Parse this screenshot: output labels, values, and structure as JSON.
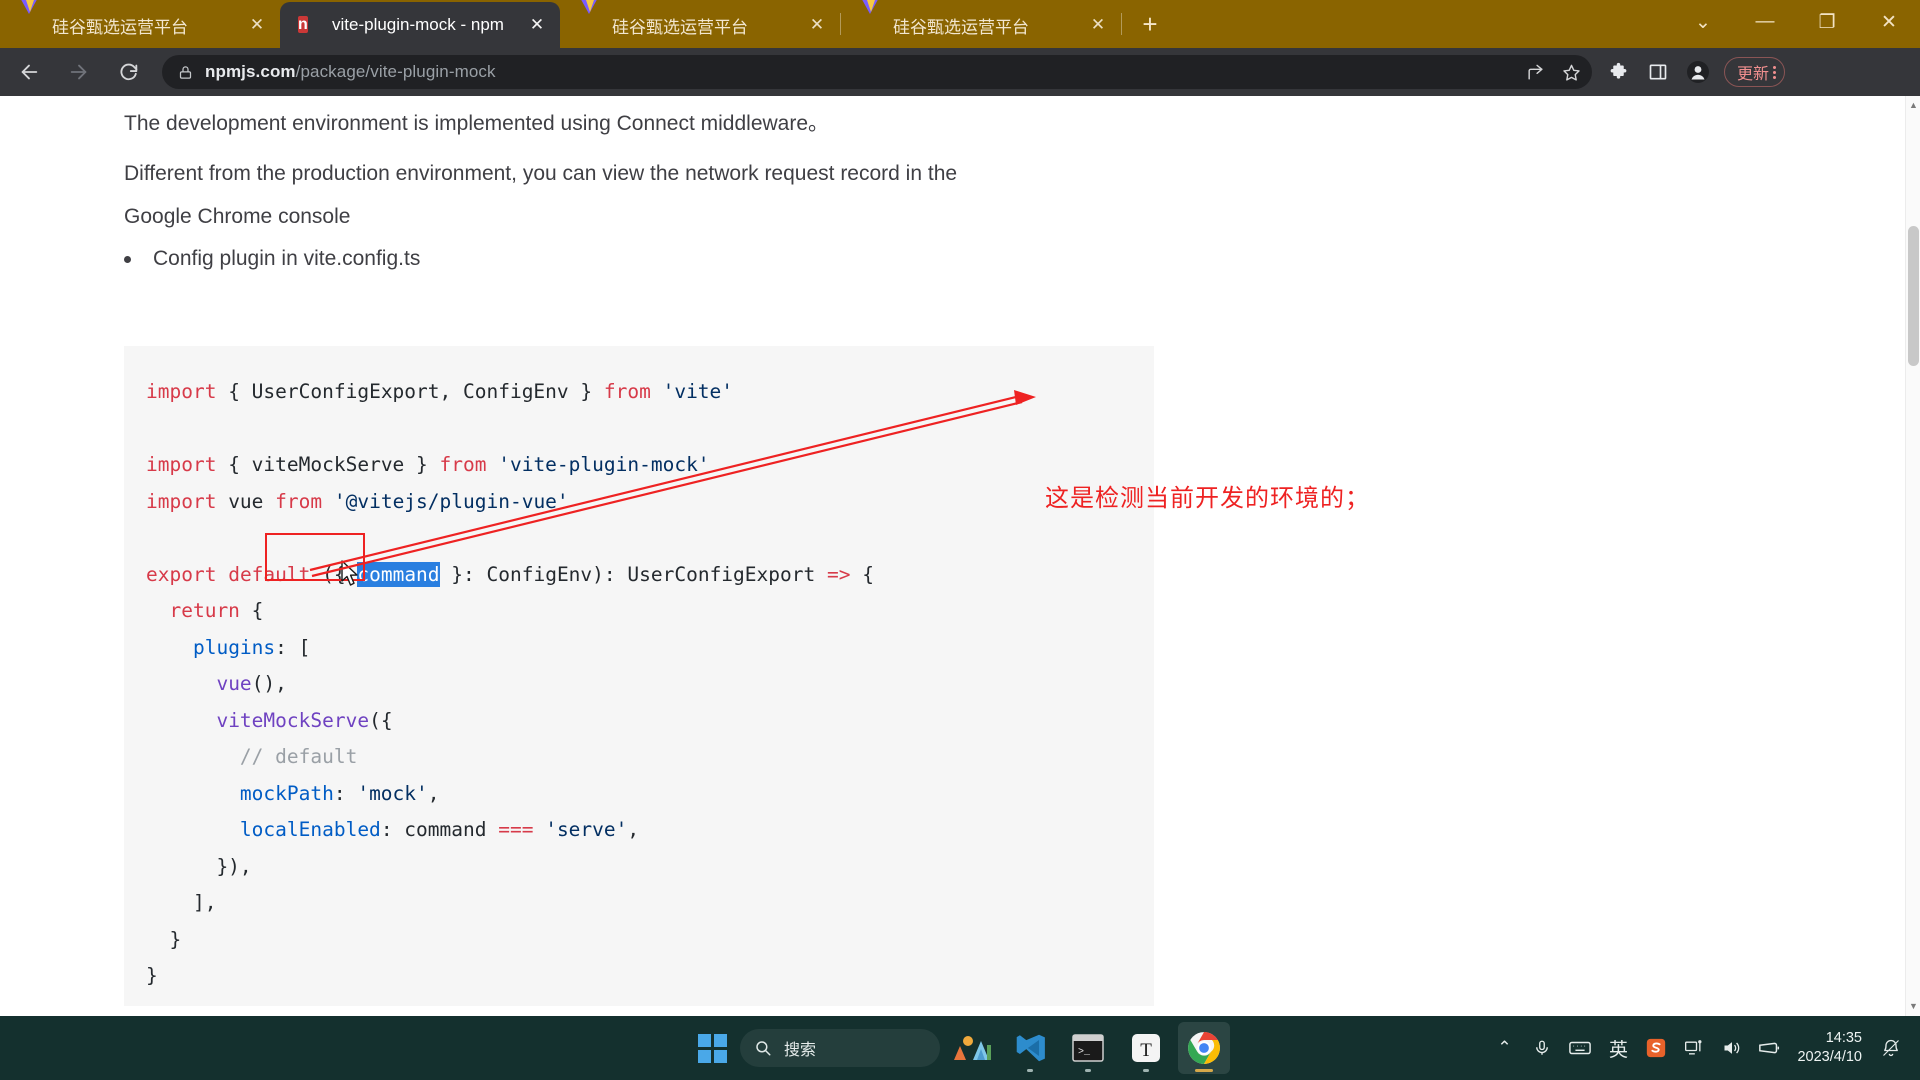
{
  "browser": {
    "tabs": [
      {
        "title": "硅谷甄选运营平台",
        "favicon": "vue-logo-icon",
        "active": false
      },
      {
        "title": "vite-plugin-mock - npm",
        "favicon": "npm-logo-icon",
        "active": true
      },
      {
        "title": "硅谷甄选运营平台",
        "favicon": "vue-logo-icon",
        "active": false
      },
      {
        "title": "硅谷甄选运营平台",
        "favicon": "vue-logo-icon",
        "active": false
      }
    ],
    "close_label": "✕",
    "new_tab_label": "+",
    "window_controls": {
      "tab_search": "⌄",
      "minimize": "—",
      "maximize": "❐",
      "close": "✕"
    },
    "toolbar": {
      "back": "←",
      "forward": "→",
      "reload": "⟳",
      "url_bold": "npmjs.com",
      "url_rest": "/package/vite-plugin-mock",
      "share_icon": "share-icon",
      "bookmark_icon": "star-icon",
      "extensions_icon": "puzzle-icon",
      "sidepanel_icon": "side-panel-icon",
      "profile_icon": "profile-avatar-icon",
      "update_label": "更新",
      "menu_icon": "kebab-menu-icon"
    }
  },
  "page": {
    "paragraphs": [
      "The development environment is implemented using Connect middleware。",
      "Different from the production environment, you can view the network request record in the",
      "Google Chrome console"
    ],
    "bullet": "Config plugin in vite.config.ts",
    "code_lines": [
      [
        {
          "t": "import",
          "c": "k"
        },
        {
          "t": " { UserConfigExport, ConfigEnv } ",
          "c": "pl"
        },
        {
          "t": "from",
          "c": "k"
        },
        {
          "t": " 'vite'",
          "c": "s"
        }
      ],
      [],
      [
        {
          "t": "import",
          "c": "k"
        },
        {
          "t": " { viteMockServe } ",
          "c": "pl"
        },
        {
          "t": "from",
          "c": "k"
        },
        {
          "t": " 'vite-plugin-mock'",
          "c": "s"
        }
      ],
      [
        {
          "t": "import",
          "c": "k"
        },
        {
          "t": " vue ",
          "c": "pl"
        },
        {
          "t": "from",
          "c": "k"
        },
        {
          "t": " '@vitejs/plugin-vue'",
          "c": "s"
        }
      ],
      [],
      [
        {
          "t": "export",
          "c": "k"
        },
        {
          "t": " ",
          "c": "pl"
        },
        {
          "t": "default",
          "c": "k"
        },
        {
          "t": " ({ ",
          "c": "pl"
        },
        {
          "t": "command",
          "c": "sel"
        },
        {
          "t": " }: ConfigEnv): UserConfigExport ",
          "c": "pl"
        },
        {
          "t": "=>",
          "c": "op"
        },
        {
          "t": " {",
          "c": "pl"
        }
      ],
      [
        {
          "t": "  ",
          "c": "pl"
        },
        {
          "t": "return",
          "c": "k"
        },
        {
          "t": " {",
          "c": "pl"
        }
      ],
      [
        {
          "t": "    ",
          "c": "pl"
        },
        {
          "t": "plugins",
          "c": "pr"
        },
        {
          "t": ": [",
          "c": "pl"
        }
      ],
      [
        {
          "t": "      ",
          "c": "pl"
        },
        {
          "t": "vue",
          "c": "p"
        },
        {
          "t": "(),",
          "c": "pl"
        }
      ],
      [
        {
          "t": "      ",
          "c": "pl"
        },
        {
          "t": "viteMockServe",
          "c": "p"
        },
        {
          "t": "({",
          "c": "pl"
        }
      ],
      [
        {
          "t": "        // default",
          "c": "cm"
        }
      ],
      [
        {
          "t": "        ",
          "c": "pl"
        },
        {
          "t": "mockPath",
          "c": "pr"
        },
        {
          "t": ": ",
          "c": "pl"
        },
        {
          "t": "'mock'",
          "c": "s"
        },
        {
          "t": ",",
          "c": "pl"
        }
      ],
      [
        {
          "t": "        ",
          "c": "pl"
        },
        {
          "t": "localEnabled",
          "c": "pr"
        },
        {
          "t": ": command ",
          "c": "pl"
        },
        {
          "t": "===",
          "c": "op"
        },
        {
          "t": " ",
          "c": "pl"
        },
        {
          "t": "'serve'",
          "c": "s"
        },
        {
          "t": ",",
          "c": "pl"
        }
      ],
      [
        {
          "t": "      }),",
          "c": "pl"
        }
      ],
      [
        {
          "t": "    ],",
          "c": "pl"
        }
      ],
      [
        {
          "t": "  }",
          "c": "pl"
        }
      ],
      [
        {
          "t": "}",
          "c": "pl"
        }
      ]
    ],
    "selected_token": "command",
    "annotation": "这是检测当前开发的环境的；",
    "annotation_color": "#ee2222"
  },
  "taskbar": {
    "start_label": "start-button",
    "search_placeholder": "搜索",
    "apps": [
      {
        "name": "widgets-weather-icon",
        "label": ""
      },
      {
        "name": "vscode-icon",
        "label": ""
      },
      {
        "name": "terminal-icon",
        "label": ""
      },
      {
        "name": "typora-icon",
        "label": "T"
      },
      {
        "name": "chrome-icon",
        "label": ""
      }
    ],
    "tray": {
      "overflow": "⌃",
      "mic": "microphone-icon",
      "keyboard": "keyboard-icon",
      "ime": "英",
      "sogou": "sogou-icon",
      "network": "network-icon",
      "volume": "volume-icon",
      "battery": "battery-icon",
      "time": "14:35",
      "date": "2023/4/10",
      "notification": "notification-icon"
    }
  }
}
